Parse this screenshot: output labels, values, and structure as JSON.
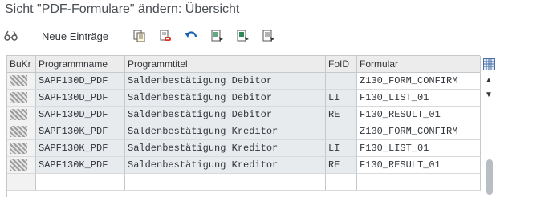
{
  "window": {
    "title": "Sicht \"PDF-Formulare\" ändern: Übersicht"
  },
  "toolbar": {
    "new_entries_label": "Neue Einträge",
    "icons": [
      "glasses-icon",
      "copy-icon",
      "delete-icon",
      "undo-icon",
      "select-all-icon",
      "select-block-icon",
      "deselect-all-icon"
    ]
  },
  "table": {
    "headers": [
      "BuKr",
      "Programmname",
      "Programmtitel",
      "FoID",
      "Formular"
    ],
    "rows": [
      {
        "bukr": "",
        "programmname": "SAPF130D_PDF",
        "programmtitel": "Saldenbestätigung Debitor",
        "foid": "",
        "formular": "Z130_FORM_CONFIRM"
      },
      {
        "bukr": "",
        "programmname": "SAPF130D_PDF",
        "programmtitel": "Saldenbestätigung Debitor",
        "foid": "LI",
        "formular": "F130_LIST_01"
      },
      {
        "bukr": "",
        "programmname": "SAPF130D_PDF",
        "programmtitel": "Saldenbestätigung Debitor",
        "foid": "RE",
        "formular": "F130_RESULT_01"
      },
      {
        "bukr": "",
        "programmname": "SAPF130K_PDF",
        "programmtitel": "Saldenbestätigung Kreditor",
        "foid": "",
        "formular": "Z130_FORM_CONFIRM"
      },
      {
        "bukr": "",
        "programmname": "SAPF130K_PDF",
        "programmtitel": "Saldenbestätigung Kreditor",
        "foid": "LI",
        "formular": "F130_LIST_01"
      },
      {
        "bukr": "",
        "programmname": "SAPF130K_PDF",
        "programmtitel": "Saldenbestätigung Kreditor",
        "foid": "RE",
        "formular": "F130_RESULT_01"
      }
    ]
  },
  "colors": {
    "header_bg": "#ececec",
    "grey_cell": "#e8ebee",
    "accent": "#0a6ed1"
  }
}
